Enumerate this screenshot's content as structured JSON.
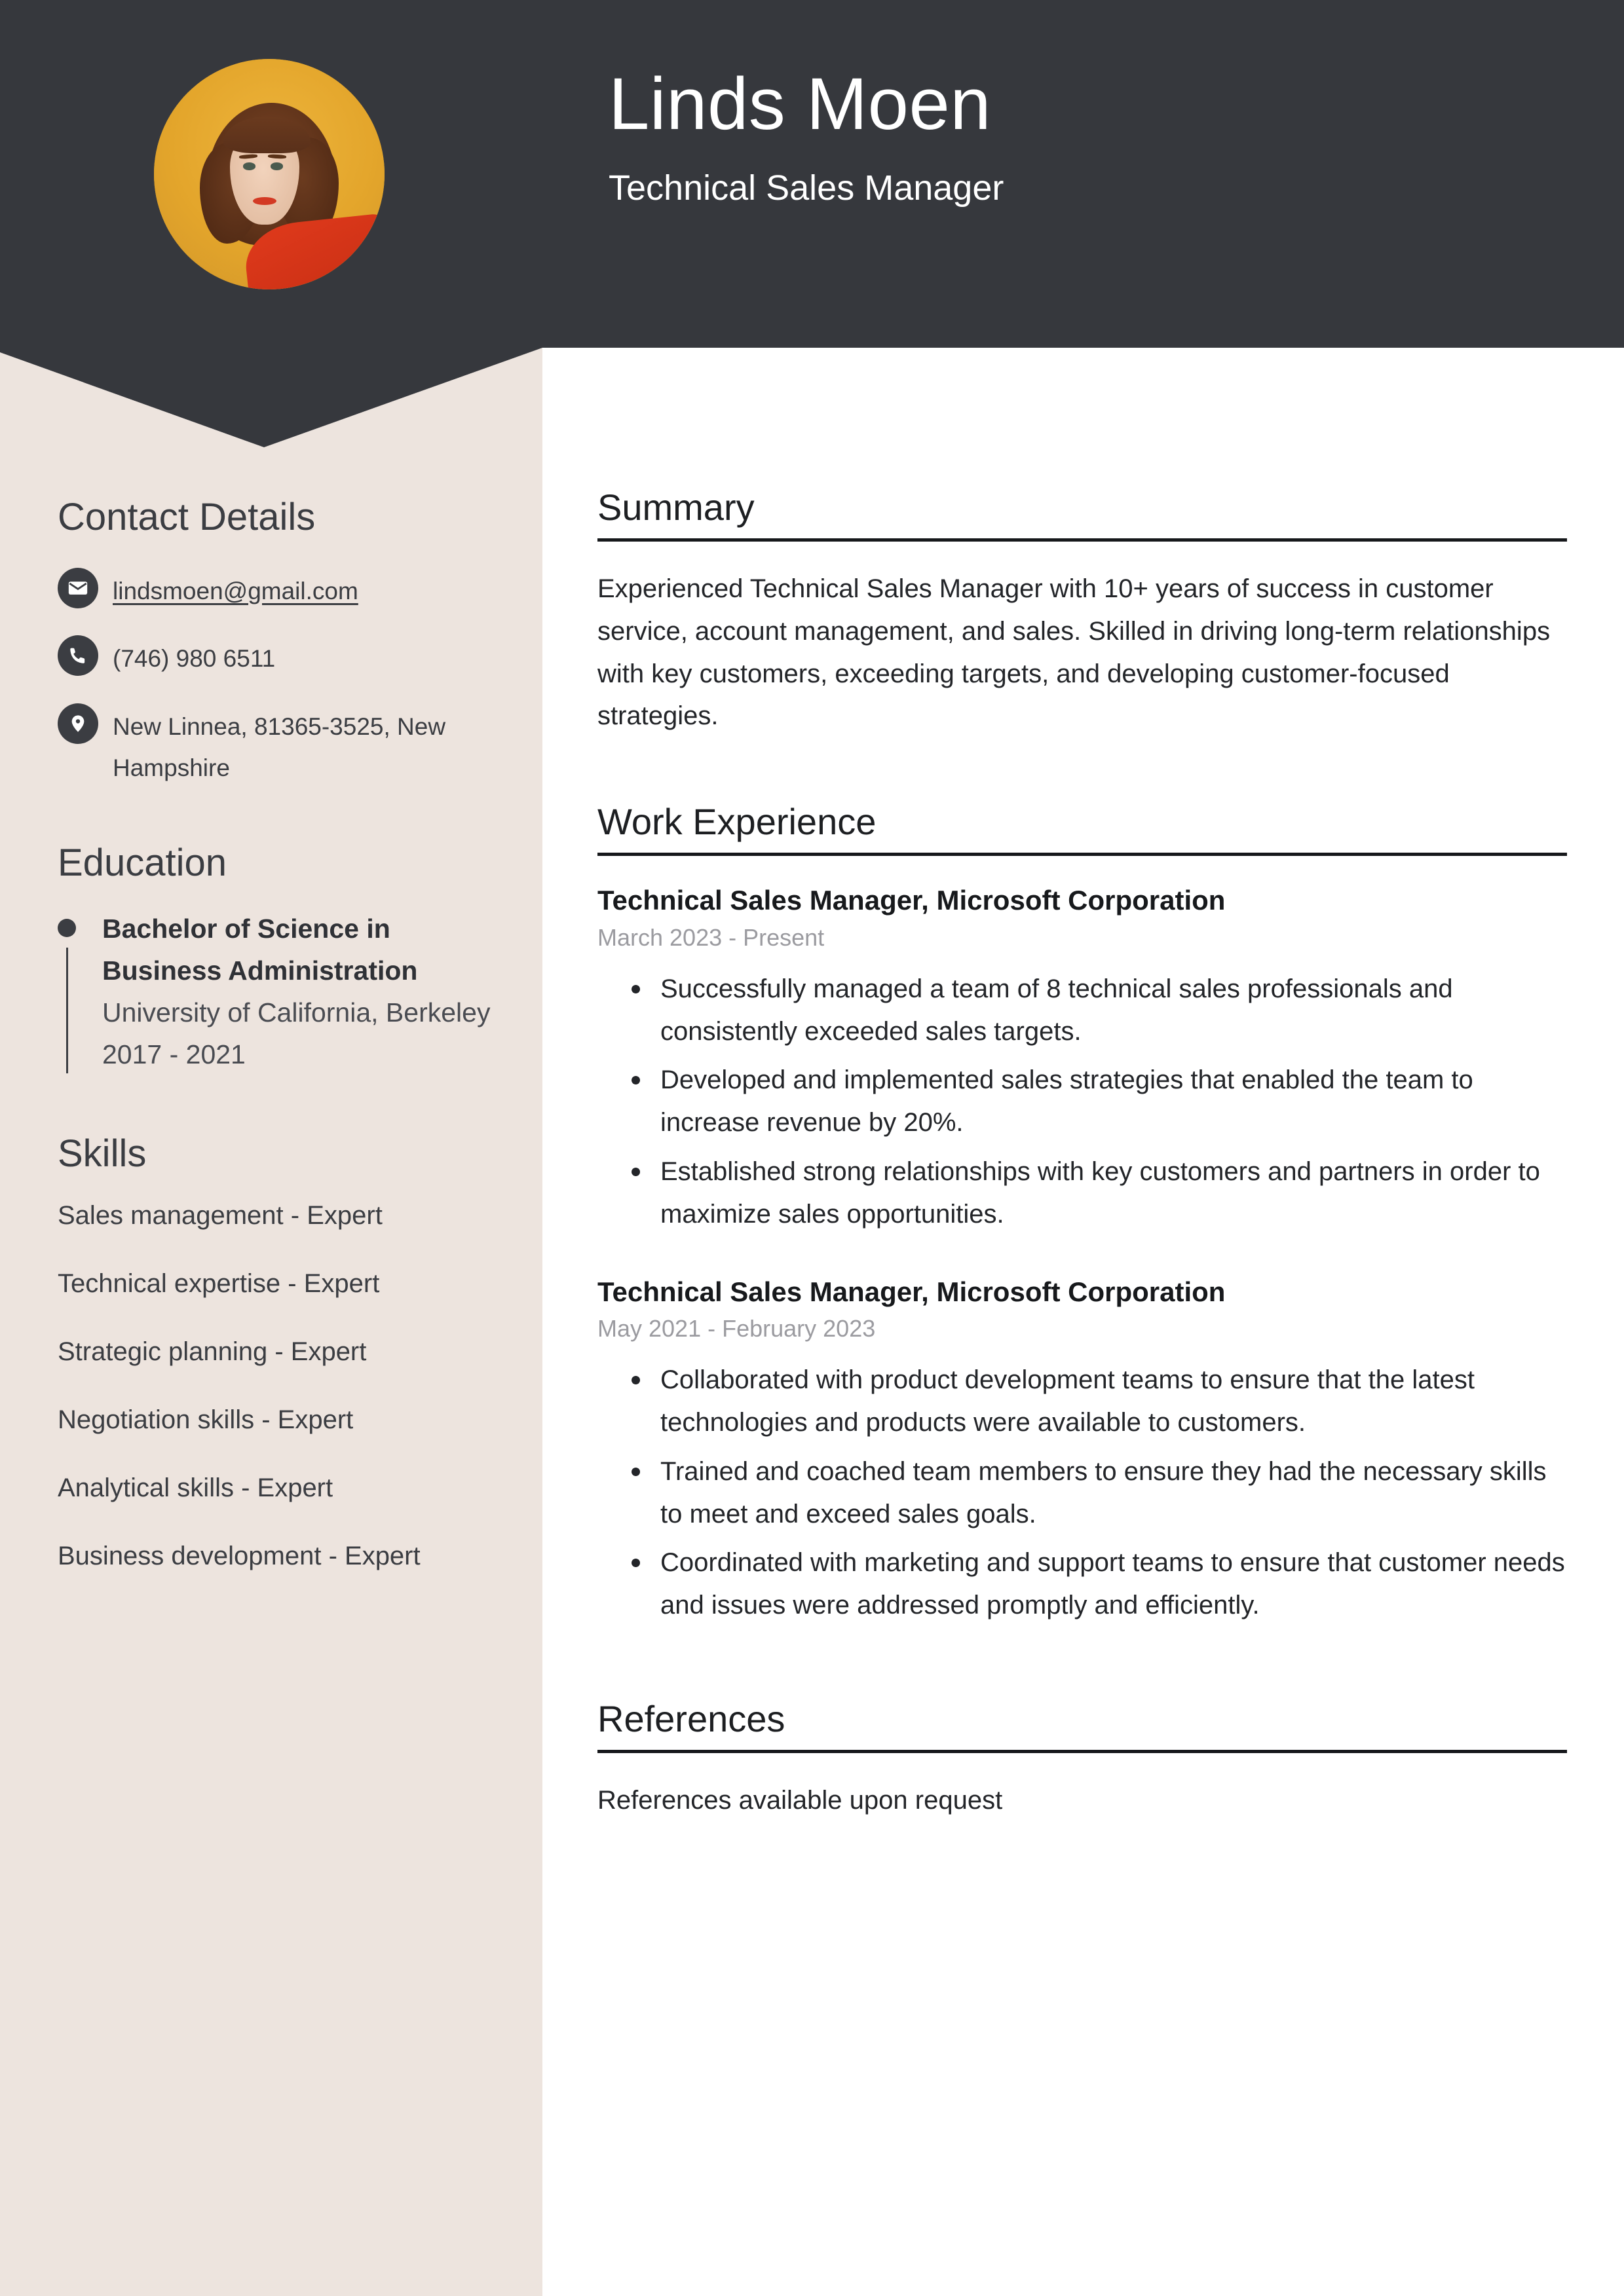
{
  "theme": {
    "header_bg": "#36383d",
    "sidebar_bg": "#ede4de",
    "main_bg": "#ffffff",
    "text_dark": "#3b3d42",
    "muted": "#9b9ba0",
    "rule": "#16181b",
    "avatar_backdrop": "#e3a52b"
  },
  "header": {
    "name": "Linds Moen",
    "job_title": "Technical Sales Manager",
    "avatar_alt": "profile-photo"
  },
  "sidebar": {
    "contact": {
      "heading": "Contact Details",
      "items": [
        {
          "icon": "envelope-icon",
          "value": "lindsmoen@gmail.com",
          "is_link": true
        },
        {
          "icon": "phone-icon",
          "value": "(746) 980 6511",
          "is_link": false
        },
        {
          "icon": "map-pin-icon",
          "value": "New Linnea, 81365-3525, New Hampshire",
          "is_link": false
        }
      ]
    },
    "education": {
      "heading": "Education",
      "entries": [
        {
          "degree": "Bachelor of Science in Business Administration",
          "institution": "University of California, Berkeley",
          "dates": "2017 - 2021"
        }
      ]
    },
    "skills": {
      "heading": "Skills",
      "items": [
        "Sales management - Expert",
        "Technical expertise - Expert",
        "Strategic planning - Expert",
        "Negotiation skills - Expert",
        "Analytical skills - Expert",
        "Business development - Expert"
      ]
    }
  },
  "main": {
    "summary": {
      "heading": "Summary",
      "text": "Experienced Technical Sales Manager with 10+ years of success in customer service, account management, and sales. Skilled in driving long-term relationships with key customers, exceeding targets, and developing customer-focused strategies."
    },
    "work_experience": {
      "heading": "Work Experience",
      "jobs": [
        {
          "role": "Technical Sales Manager, Microsoft Corporation",
          "dates": "March 2023 - Present",
          "bullets": [
            "Successfully managed a team of 8 technical sales professionals and consistently exceeded sales targets.",
            "Developed and implemented sales strategies that enabled the team to increase revenue by 20%.",
            "Established strong relationships with key customers and partners in order to maximize sales opportunities."
          ]
        },
        {
          "role": "Technical Sales Manager, Microsoft Corporation",
          "dates": "May 2021 - February 2023",
          "bullets": [
            "Collaborated with product development teams to ensure that the latest technologies and products were available to customers.",
            "Trained and coached team members to ensure they had the necessary skills to meet and exceed sales goals.",
            "Coordinated with marketing and support teams to ensure that customer needs and issues were addressed promptly and efficiently."
          ]
        }
      ]
    },
    "references": {
      "heading": "References",
      "text": "References available upon request"
    }
  }
}
